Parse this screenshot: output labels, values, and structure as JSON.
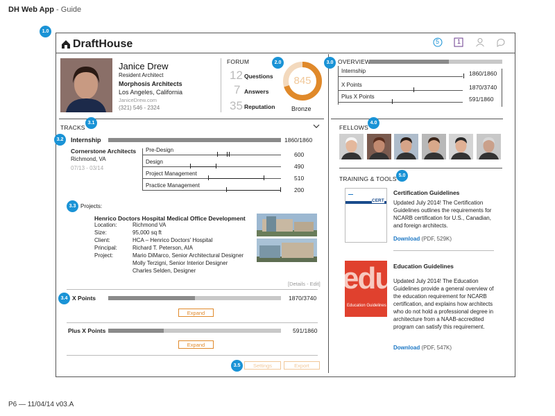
{
  "doc": {
    "title_bold": "DH Web App",
    "title_rest": " - Guide",
    "footer": "P6 — 11/04/14 v03.A"
  },
  "badges": {
    "b10": "1.0",
    "b20": "2.0",
    "b30": "3.0",
    "b31": "3.1",
    "b32": "3.2",
    "b33": "3.3",
    "b34": "3.4",
    "b35": "3.5",
    "b40": "4.0",
    "b50": "5.0"
  },
  "header": {
    "logo": "DraftHouse",
    "notif_count": "5",
    "msg_count": "1"
  },
  "profile": {
    "name": "Janice Drew",
    "role": "Resident Architect",
    "company": "Morphosis Architects",
    "location": "Los Angeles, California",
    "email": "JaniceDrew.com",
    "phone": "(321) 546 - 2324"
  },
  "forum": {
    "label": "FORUM",
    "questions_num": "12",
    "questions_label": "Questions",
    "answers_num": "7",
    "answers_label": "Answers",
    "rep_num": "35",
    "rep_label": "Reputation",
    "score": "845",
    "score_fraction": 0.7,
    "level": "Bronze"
  },
  "overview": {
    "label": "OVERVIEW",
    "progress": 0.6,
    "rows": [
      {
        "label": "Internship",
        "value": "1860/1860",
        "progress": 1.0
      },
      {
        "label": "X Points",
        "value": "1870/3740",
        "progress": 0.5
      },
      {
        "label": "Plus X Points",
        "value": "591/1860",
        "progress": 0.32
      }
    ]
  },
  "tracks": {
    "label": "TRACKS",
    "internship": {
      "label": "Internship",
      "value": "1860/1860",
      "progress": 1.0,
      "firm": "Cornerstone Architects",
      "city": "Richmond, VA",
      "dates": "07/13 - 03/14",
      "cats": [
        {
          "label": "Pre-Design",
          "value": "600"
        },
        {
          "label": "Design",
          "value": "490"
        },
        {
          "label": "Project Management",
          "value": "510"
        },
        {
          "label": "Practice Management",
          "value": "200"
        }
      ]
    },
    "projects_label": "Projects:",
    "project": {
      "title": "Henrico Doctors Hospital Medical Office Development",
      "rows": [
        {
          "k": "Location:",
          "v": "Richmond VA"
        },
        {
          "k": "Size:",
          "v": "95,000 sq ft"
        },
        {
          "k": "Client:",
          "v": "HCA – Henrico Doctors' Hospital"
        },
        {
          "k": "Principal:",
          "v": "Richard T. Peterson, AIA"
        },
        {
          "k": "Project:",
          "v": "Mario DiMarco, Senior Architectural Designer"
        },
        {
          "k": "",
          "v": "Molly Terzigni, Senior Interior Designer"
        },
        {
          "k": "",
          "v": "Charles Selden, Designer"
        }
      ],
      "details": "[Details - Edit]"
    },
    "xpoints": {
      "label": "X Points",
      "value": "1870/3740",
      "progress": 0.5,
      "expand": "Expand"
    },
    "plusx": {
      "label": "Plus X Points",
      "value": "591/1860",
      "progress": 0.32,
      "expand": "Expand"
    },
    "settings": "Settings",
    "export": "Export"
  },
  "fellows": {
    "label": "FELLOWS"
  },
  "training": {
    "label": "TRAINING & TOOLS",
    "items": [
      {
        "title": "Certification Guidelines",
        "desc": "Updated July 2014! The Certification Guidelines outlines the requirements for NCARB certification for U.S., Canadian, and foreign architects.",
        "link": "Download",
        "meta": "(PDF, 529K)",
        "thumb": "CERT"
      },
      {
        "title": "Education Guidelines",
        "desc": "Updated July 2014! The Education Guidelines provide a general overview of the education requirement for NCARB certification, and explains how architects who do not hold a professional degree in architecture from a NAAB-accredited program can satisfy this requirement.",
        "link": "Download",
        "meta": "(PDF, 547K)",
        "thumb": "edu",
        "thumb_sub": "Education Guidelines"
      }
    ]
  }
}
